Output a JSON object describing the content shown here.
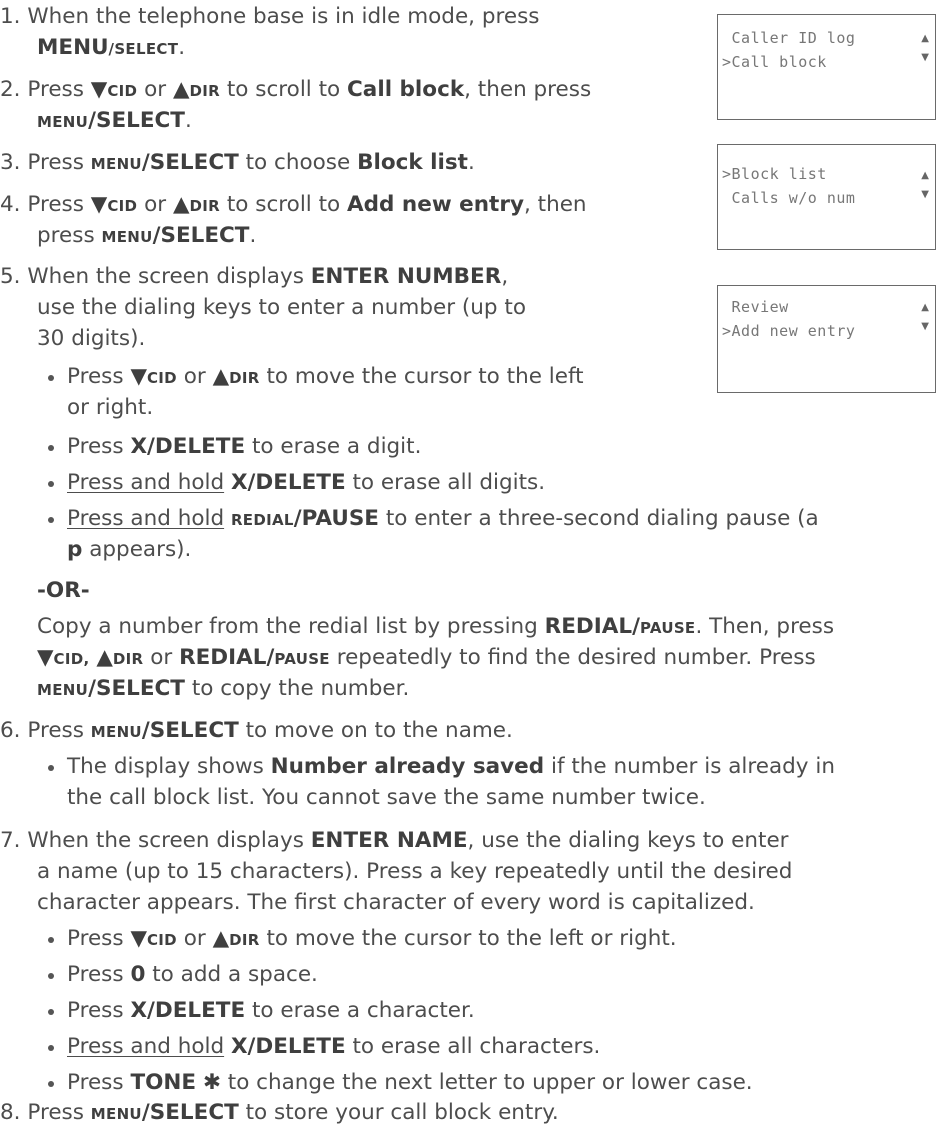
{
  "screens": [
    {
      "line1": " Caller ID log",
      "line2": ">Call block",
      "up": "▲",
      "down": "▼"
    },
    {
      "line1": ">Block list",
      "line2": " Calls w/o num",
      "up": "▲",
      "down": "▼"
    },
    {
      "line1": " Review",
      "line2": ">Add new entry",
      "up": "▲",
      "down": "▼"
    }
  ],
  "t": {
    "n1": "1.",
    "s1a": "When the telephone base is in idle mode, press",
    "k_menu": "MENU",
    "k_slash_select": "/SELECT",
    "s1b_small": "SELECT",
    "dot": ".",
    "n2": "2.",
    "press": "Press",
    "k_down": "▼",
    "k_cid": "CID",
    "or": "or",
    "k_up": "▲",
    "k_dir": "DIR",
    "to_scroll": "to scroll to",
    "call_block": "Call block",
    "then_press": ", then press",
    "menu_small": "MENU",
    "slash_select": "/SELECT",
    "n3": "3.",
    "to_choose": "to choose",
    "block_list": "Block list",
    "n4": "4.",
    "add_new_entry": "Add new entry",
    "then": ", then",
    "press_lc": "press",
    "n5": "5.",
    "s5a": "When the screen displays",
    "enter_number": "ENTER NUMBER",
    "comma": ",",
    "s5b": "use the dialing keys to enter a number (up to",
    "s5c": "30 digits).",
    "move_cursor_a": "to move the cursor to the left",
    "move_cursor_b": "or right.",
    "x_delete": "X/DELETE",
    "erase_digit": "to erase a digit.",
    "press_hold": "Press and hold",
    "erase_all_digits": "to erase all digits.",
    "redial_small": "REDIAL",
    "slash_pause": "/PAUSE",
    "pause_text": "to enter a three-second dialing pause (a",
    "p": "p",
    "appears": "appears).",
    "or_word": "-OR-",
    "copy_a": "Copy a number from the redial list by pressing",
    "redial": "REDIAL",
    "slash_pause_small_slash": "/",
    "pause_small": "PAUSE",
    "then_press_c": ". Then, press",
    "cid_comma": "CID,",
    "dir_or": "or",
    "repeat_text": "repeatedly to find the desired number. Press",
    "copy_num": "to copy the number.",
    "n6": "6.",
    "move_on": "to move on to the name.",
    "display_shows": "The display shows",
    "num_saved": "Number already saved",
    "if_text": "if the number is already in",
    "cant_save": "the call block list. You cannot save the same number twice.",
    "n7": "7.",
    "enter_name": "ENTER NAME",
    "s7a": ", use the dialing keys to enter",
    "s7b": "a name (up to 15 characters). Press a key repeatedly until the desired",
    "s7c": "character appears. The first character of every word is capitalized.",
    "move_cursor_full": "to move the cursor to the left or right.",
    "zero": "0",
    "add_space": "to add a space.",
    "erase_char": "to erase a character.",
    "erase_all_chars": "to erase all characters.",
    "tone": "TONE",
    "tone_sym": "✱",
    "change_case": "to change the next letter to upper or lower case.",
    "n8": "8.",
    "store": "to store your call block entry."
  }
}
